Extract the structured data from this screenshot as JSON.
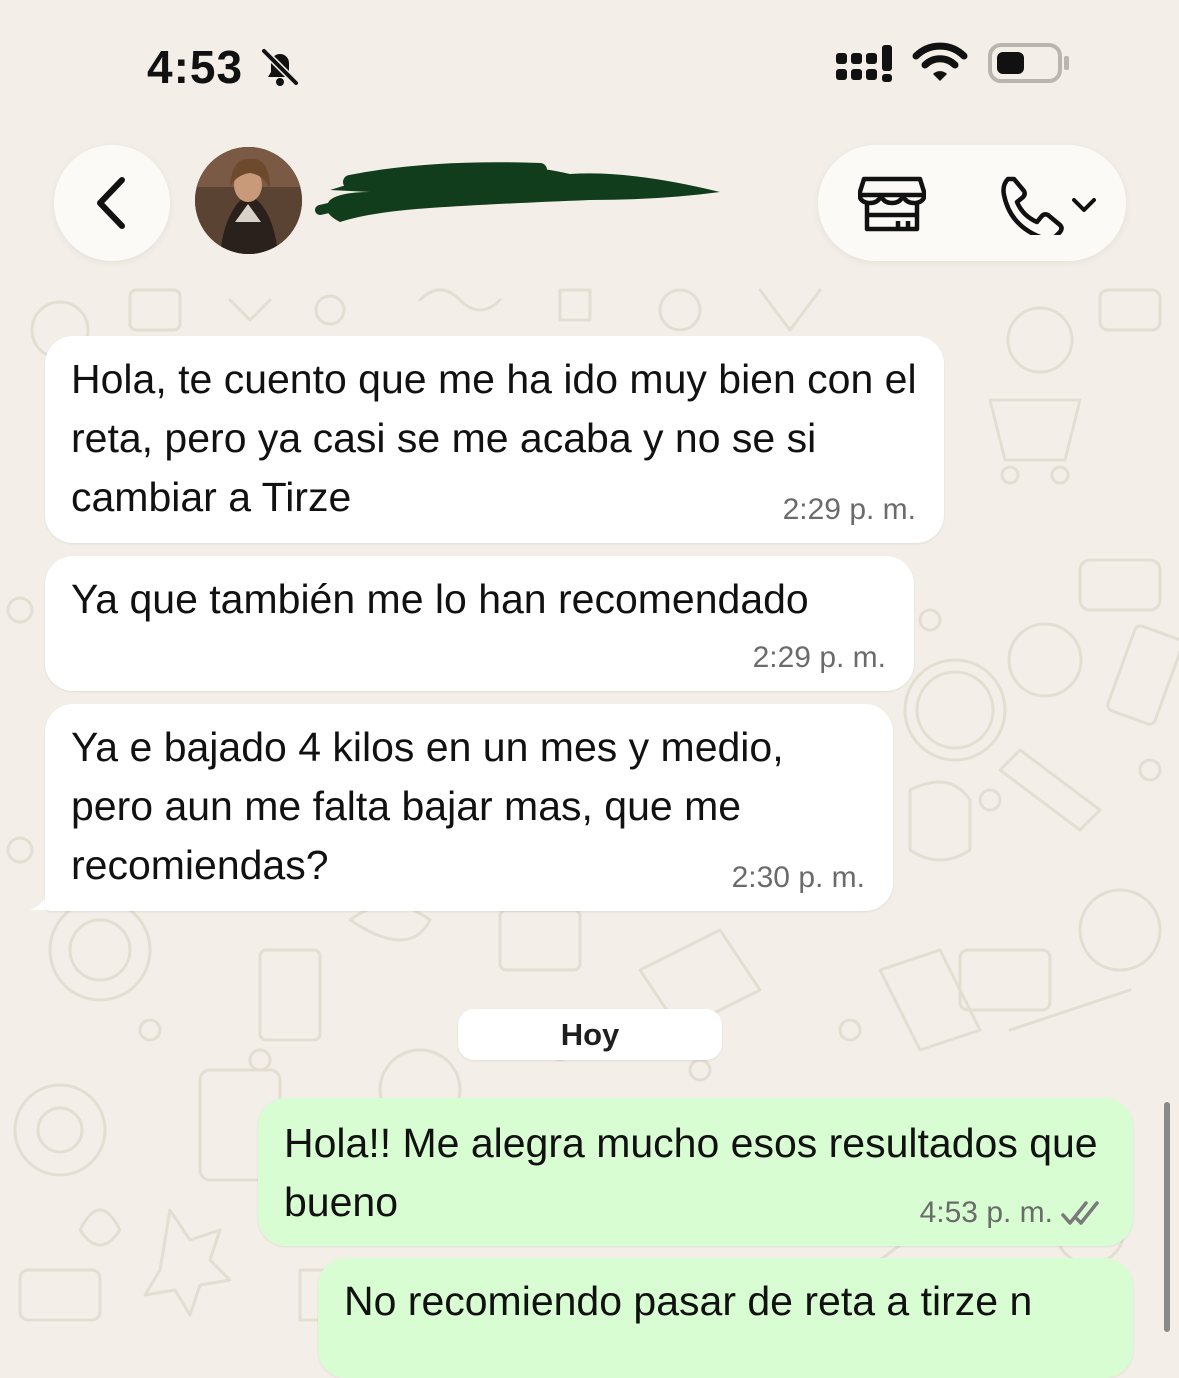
{
  "status_bar": {
    "time": "4:53"
  },
  "header": {
    "contact_name": "",
    "icons": {
      "back": "chevron-left-icon",
      "store": "store-icon",
      "call": "phone-icon",
      "call_menu": "chevron-down-icon"
    }
  },
  "messages": [
    {
      "direction": "incoming",
      "text": "Hola, te cuento que me ha ido muy bien con el reta, pero ya casi se me acaba y no se si cambiar a Tirze",
      "time": "2:29 p. m."
    },
    {
      "direction": "incoming",
      "text": "Ya que también me lo han recomendado",
      "time": "2:29 p. m."
    },
    {
      "direction": "incoming",
      "text": "Ya e bajado 4 kilos en un mes y medio, pero aun me falta bajar mas, que me recomiendas?",
      "time": "2:30 p. m."
    },
    {
      "direction": "outgoing",
      "text": "Hola!! Me alegra mucho esos resultados que bueno",
      "time": "4:53 p. m.",
      "status": "read"
    },
    {
      "direction": "outgoing",
      "text": "No recomiendo pasar de reta a tirze n",
      "time": ""
    }
  ],
  "date_separator": "Hoy",
  "colors": {
    "background": "#f3efe8",
    "incoming_bubble": "#ffffff",
    "outgoing_bubble": "#d9fdd3",
    "read_ticks": "#7a7a7a",
    "redaction": "#123d1c"
  }
}
